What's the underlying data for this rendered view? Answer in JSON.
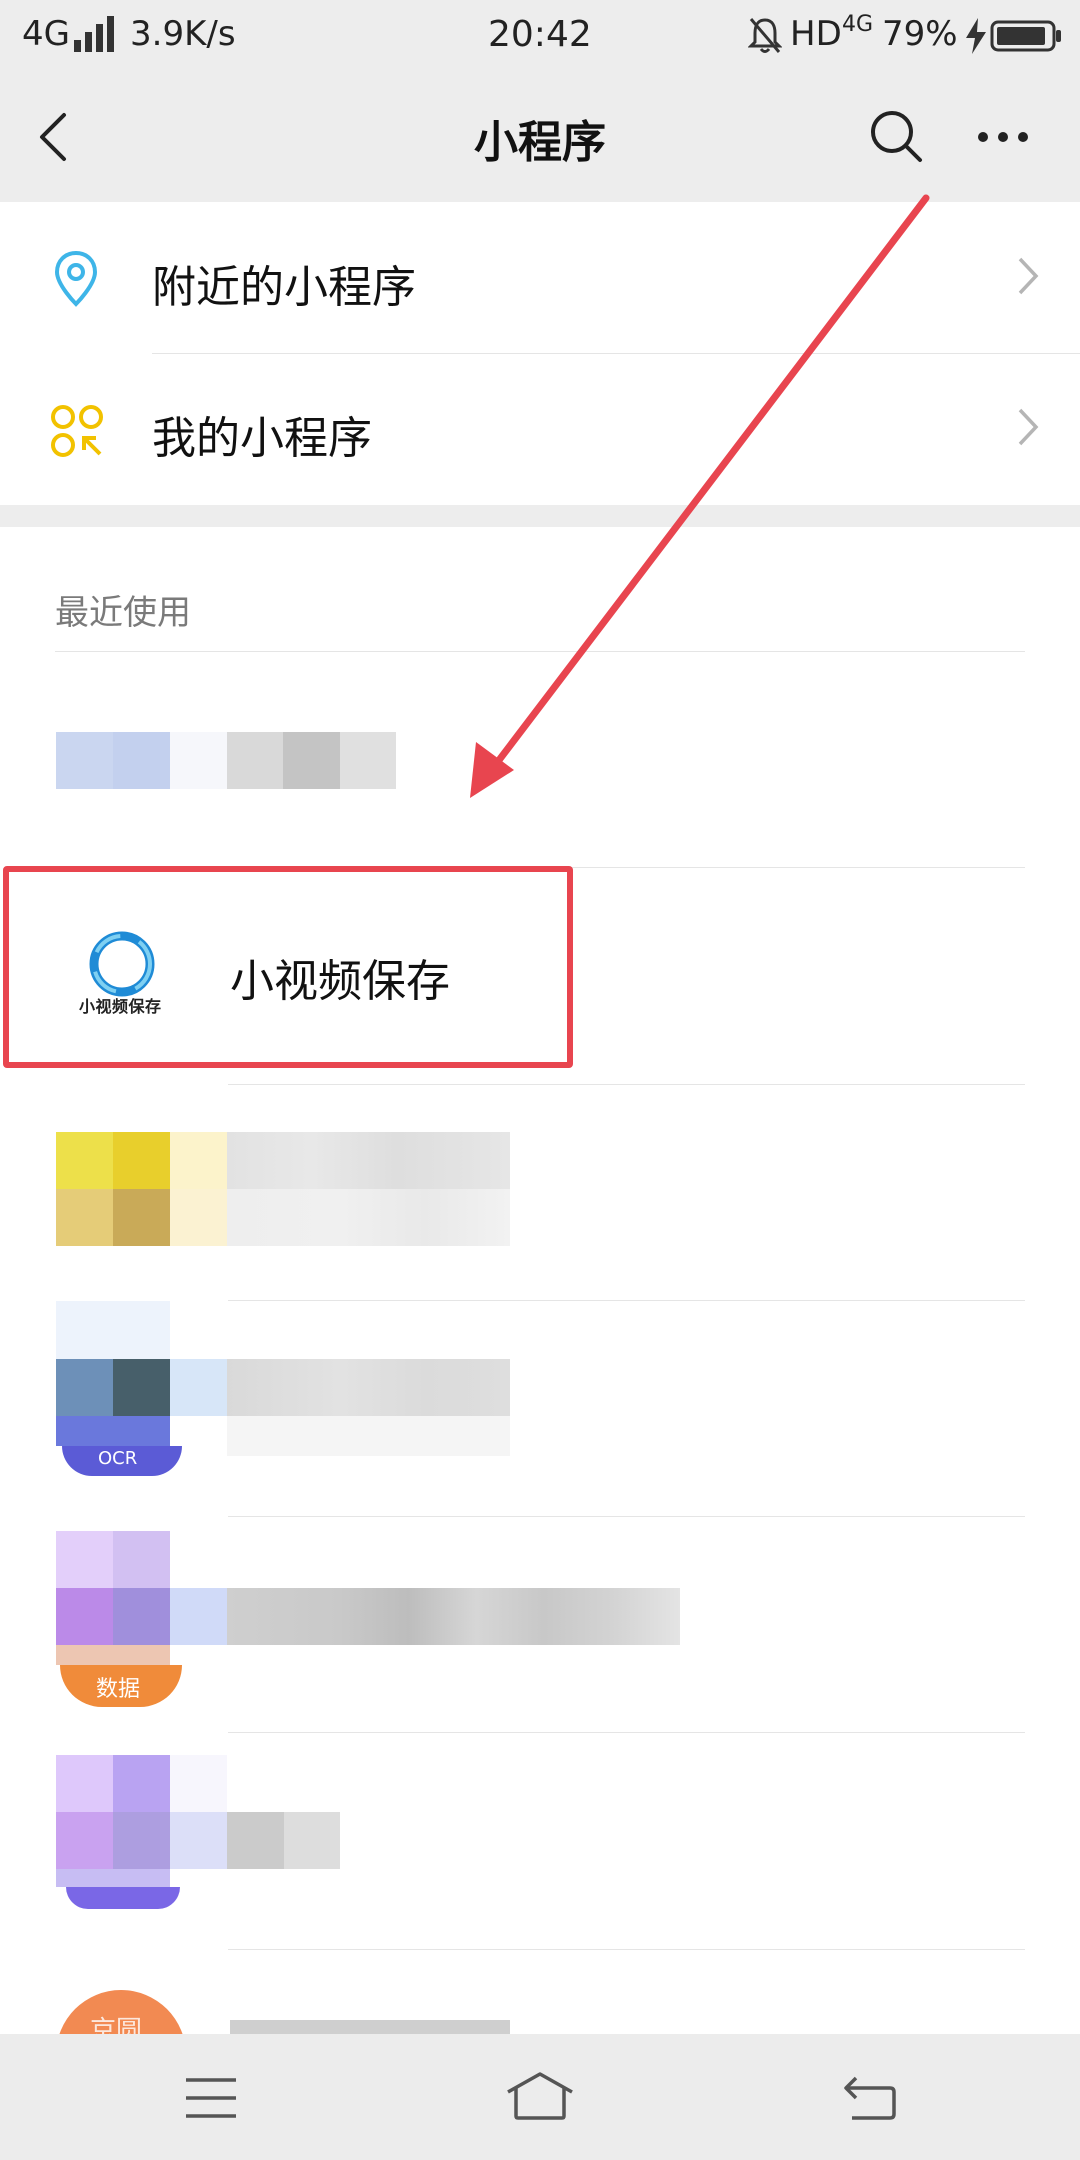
{
  "status_bar": {
    "network": "4G",
    "speed": "3.9K/s",
    "time": "20:42",
    "hd": "HD",
    "net2": "4G",
    "battery": "79%"
  },
  "nav": {
    "title": "小程序",
    "back_icon": "back-arrow-icon",
    "search_icon": "search-icon",
    "more_icon": "more-icon"
  },
  "menu": [
    {
      "label": "附近的小程序",
      "icon": "location-pin-icon",
      "color": "#3eb5e8"
    },
    {
      "label": "我的小程序",
      "icon": "mini-program-grid-icon",
      "color": "#f2c200"
    }
  ],
  "recent": {
    "title": "最近使用",
    "items": [
      {
        "name": ""
      },
      {
        "name": "小视频保存",
        "logo_text": "小视频保存"
      },
      {
        "name": ""
      },
      {
        "name": "",
        "badge": "OCR"
      },
      {
        "name": "",
        "badge": "数据"
      },
      {
        "name": ""
      },
      {
        "name": "",
        "badge": "京圆"
      }
    ]
  },
  "annotation": {
    "color": "#e8454f"
  },
  "bottom_nav": {
    "menu_icon": "menu-icon",
    "home_icon": "home-icon",
    "back_icon": "return-icon"
  }
}
